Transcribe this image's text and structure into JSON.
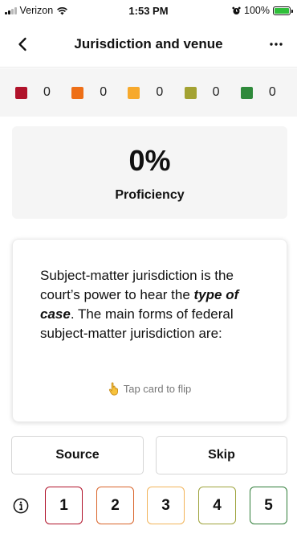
{
  "status_bar": {
    "carrier": "Verizon",
    "time": "1:53 PM",
    "battery": "100%",
    "icons": [
      "signal-icon",
      "wifi-icon",
      "alarm-icon",
      "battery-charging-icon"
    ]
  },
  "nav": {
    "title": "Jurisdiction and venue",
    "icons": [
      "back-chevron-icon",
      "more-dots-icon"
    ]
  },
  "stats": [
    {
      "color": "#b0122a",
      "count": "0"
    },
    {
      "color": "#ee6f17",
      "count": "0"
    },
    {
      "color": "#f7a92c",
      "count": "0"
    },
    {
      "color": "#a3a232",
      "count": "0"
    },
    {
      "color": "#2f8a3b",
      "count": "0"
    }
  ],
  "proficiency": {
    "percent": "0%",
    "label": "Proficiency"
  },
  "card": {
    "text_1": "Subject-matter jurisdiction is the court’s power to hear the ",
    "text_bold": "type of case",
    "text_2": ". The main forms of federal subject-matter jurisdiction are:",
    "flip_hint": "Tap card to flip",
    "flip_icon": "pointing-hand-icon"
  },
  "actions": {
    "source_label": "Source",
    "skip_label": "Skip"
  },
  "rating": {
    "info_icon": "info-icon",
    "buttons": [
      {
        "label": "1",
        "color": "#b0122a"
      },
      {
        "label": "2",
        "color": "#d9642a"
      },
      {
        "label": "3",
        "color": "#f2b45a"
      },
      {
        "label": "4",
        "color": "#9ea33c"
      },
      {
        "label": "5",
        "color": "#2f7d38"
      }
    ]
  }
}
